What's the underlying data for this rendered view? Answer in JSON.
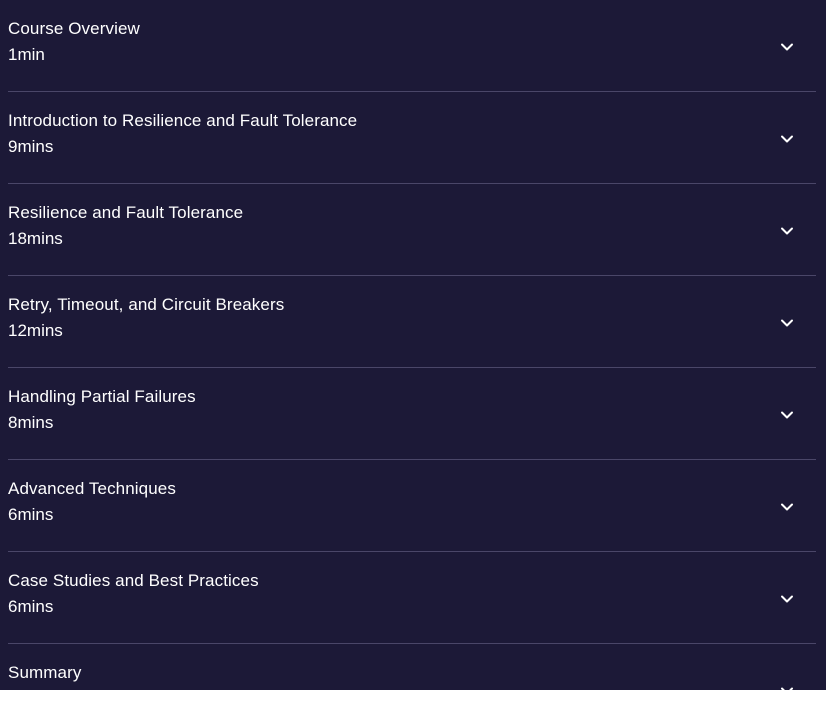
{
  "modules": [
    {
      "title": "Course Overview",
      "duration": "1min"
    },
    {
      "title": "Introduction to Resilience and Fault Tolerance",
      "duration": "9mins"
    },
    {
      "title": "Resilience and Fault Tolerance",
      "duration": "18mins"
    },
    {
      "title": "Retry, Timeout, and Circuit Breakers",
      "duration": "12mins"
    },
    {
      "title": "Handling Partial Failures",
      "duration": "8mins"
    },
    {
      "title": "Advanced Techniques",
      "duration": "6mins"
    },
    {
      "title": "Case Studies and Best Practices",
      "duration": "6mins"
    },
    {
      "title": "Summary",
      "duration": ""
    }
  ],
  "icons": {
    "expand": "chevron-down-icon"
  },
  "colors": {
    "background": "#1c1937",
    "text": "#ffffff",
    "divider": "#4a4668"
  }
}
